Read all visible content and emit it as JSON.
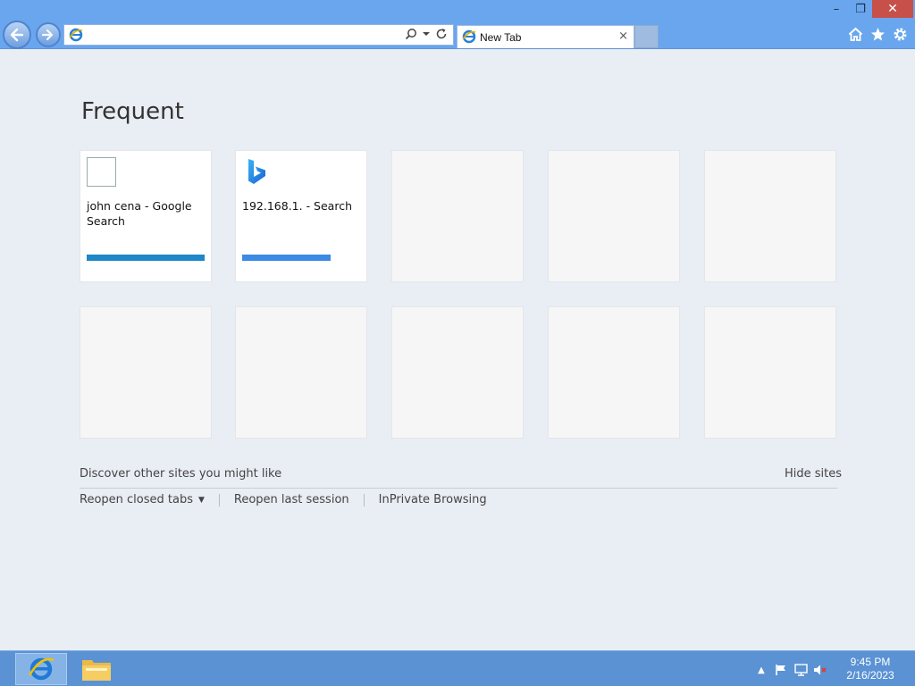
{
  "window": {
    "minimize_glyph": "–",
    "maximize_glyph": "❐",
    "close_glyph": "✕"
  },
  "address_bar": {
    "value": "",
    "placeholder": ""
  },
  "tab": {
    "label": "New Tab",
    "close_glyph": "×"
  },
  "main": {
    "heading": "Frequent",
    "tiles": [
      {
        "title": "john cena - Google Search",
        "bar_color": "#1e87c8",
        "bar_fraction": 1.0,
        "icon": "blank-page-icon"
      },
      {
        "title": "192.168.1. - Search",
        "bar_color": "#3b8ae6",
        "bar_fraction": 0.75,
        "icon": "bing-icon"
      }
    ],
    "discover_text": "Discover other sites you might like",
    "hide_sites": "Hide sites",
    "links": {
      "reopen_closed_tabs": "Reopen closed tabs",
      "reopen_last_session": "Reopen last session",
      "inprivate": "InPrivate Browsing"
    }
  },
  "taskbar": {
    "time": "9:45 PM",
    "date": "2/16/2023"
  },
  "colors": {
    "chrome_blue": "#6aa6ee",
    "taskbar_blue": "#5a92d3",
    "page_background": "#e9edf4"
  }
}
